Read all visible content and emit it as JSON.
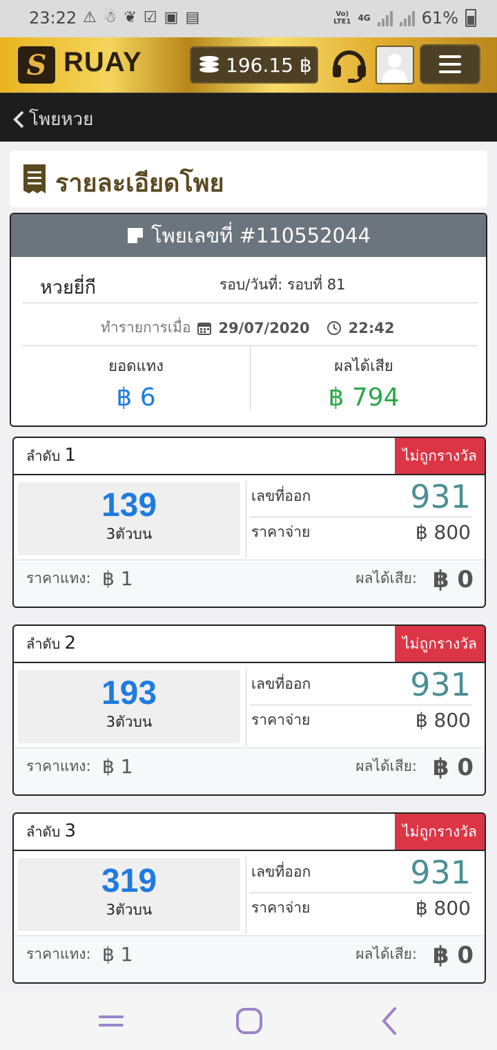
{
  "status_bar": {
    "time": "23:22",
    "network_top": "Vo)",
    "network_bottom": "LTE1",
    "network_type": "4G",
    "battery": "61%"
  },
  "header": {
    "logo_letter": "S",
    "brand": "RUAY",
    "balance": "196.15 ฿",
    "accent_color": "#e9b420"
  },
  "subnav": {
    "back_label": "โพยหวย"
  },
  "page": {
    "title": "รายละเอียดโพย"
  },
  "ticket": {
    "title": "โพยเลขที่ #110552044",
    "lottery_name": "หวยยี่กี",
    "round_label": "รอบ/วันที่: รอบที่ 81",
    "made_at_label": "ทำรายการเมื่อ",
    "date": "29/07/2020",
    "time": "22:42",
    "stake_label": "ยอดแทง",
    "stake_value": "฿ 6",
    "pl_label": "ผลได้เสีย",
    "pl_value": "฿ 794"
  },
  "bets": [
    {
      "order_label": "ลำดับ",
      "order": "1",
      "status": "ไม่ถูกรางวัล",
      "number": "139",
      "bet_type": "3ตัวบน",
      "result_label": "เลขที่ออก",
      "result": "931",
      "payout_label": "ราคาจ่าย",
      "payout": "฿ 800",
      "stake_label": "ราคาแทง:",
      "stake": "฿ 1",
      "pl_label": "ผลได้เสีย:",
      "pl": "฿ 0"
    },
    {
      "order_label": "ลำดับ",
      "order": "2",
      "status": "ไม่ถูกรางวัล",
      "number": "193",
      "bet_type": "3ตัวบน",
      "result_label": "เลขที่ออก",
      "result": "931",
      "payout_label": "ราคาจ่าย",
      "payout": "฿ 800",
      "stake_label": "ราคาแทง:",
      "stake": "฿ 1",
      "pl_label": "ผลได้เสีย:",
      "pl": "฿ 0"
    },
    {
      "order_label": "ลำดับ",
      "order": "3",
      "status": "ไม่ถูกรางวัล",
      "number": "319",
      "bet_type": "3ตัวบน",
      "result_label": "เลขที่ออก",
      "result": "931",
      "payout_label": "ราคาจ่าย",
      "payout": "฿ 800",
      "stake_label": "ราคาแทง:",
      "stake": "฿ 1",
      "pl_label": "ผลได้เสีย:",
      "pl": "฿ 0"
    }
  ],
  "colors": {
    "stake_blue": "#1e7be0",
    "profit_green": "#28a745",
    "lose_badge": "#dc3545",
    "result_teal": "#4a8f95"
  }
}
